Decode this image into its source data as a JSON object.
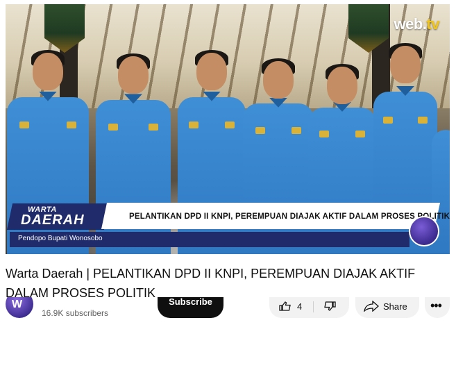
{
  "video": {
    "watermark": {
      "text": "web.",
      "accent": "tv"
    },
    "lower_third": {
      "tag_line1": "WARTA",
      "tag_line2": "DAERAH",
      "headline": "PELANTIKAN DPD II KNPI, PEREMPUAN DIAJAK AKTIF DALAM PROSES POLITIK",
      "location": "Pendopo Bupati Wonosobo"
    },
    "colors": {
      "shirt": "#3f8fd6",
      "lower_third_navy": "#1f2b6b"
    }
  },
  "title": "Warta Daerah | PELANTIKAN DPD II KNPI, PEREMPUAN DIAJAK AKTIF DALAM PROSES POLITIK",
  "channel": {
    "avatar_letter": "W",
    "subscribers": "16.9K subscribers",
    "subscribe_label": "Subscribe"
  },
  "actions": {
    "like_count": "4",
    "like_icon": "thumbs-up-icon",
    "dislike_icon": "thumbs-down-icon",
    "share_label": "Share",
    "share_icon": "share-icon",
    "more_icon": "more-icon"
  }
}
